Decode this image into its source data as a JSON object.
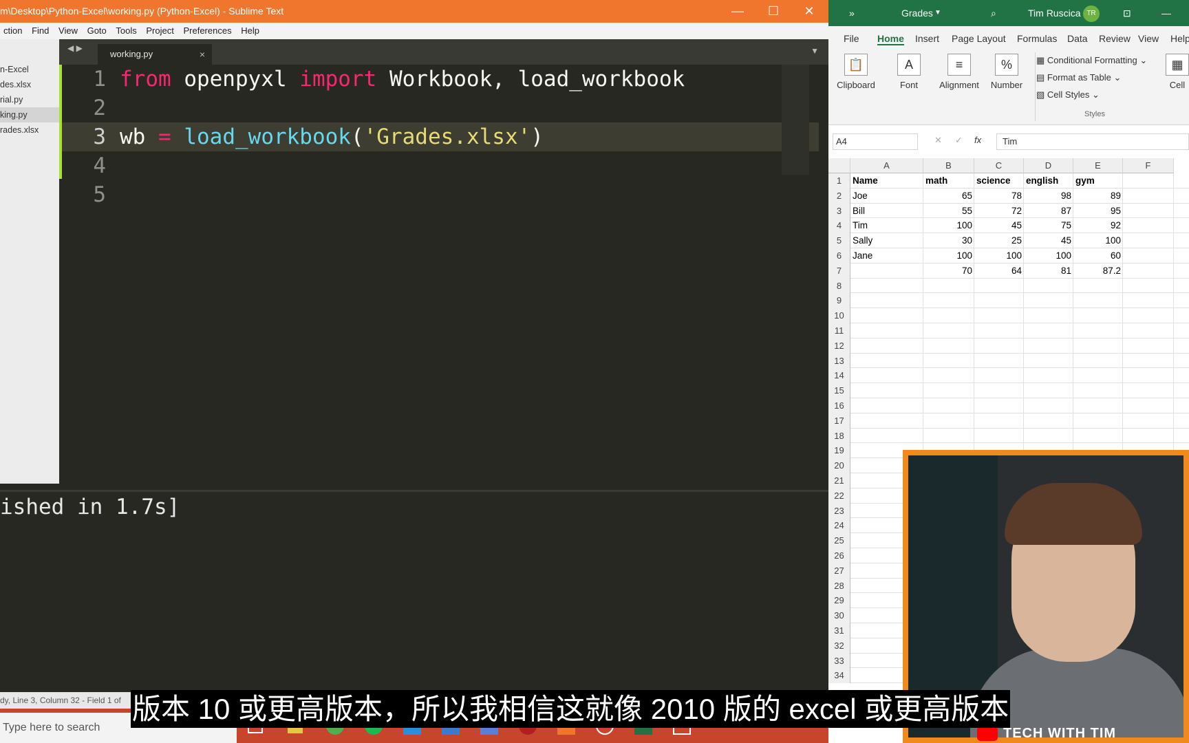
{
  "sublime": {
    "title": "m\\Desktop\\Python-Excel\\working.py (Python-Excel) - Sublime Text",
    "menu": [
      "ction",
      "Find",
      "View",
      "Goto",
      "Tools",
      "Project",
      "Preferences",
      "Help"
    ],
    "sidebar_files": [
      "n-Excel",
      "des.xlsx",
      "rial.py",
      "king.py",
      "rades.xlsx"
    ],
    "tab_label": "working.py",
    "line_numbers": [
      "1",
      "2",
      "3",
      "4",
      "5"
    ],
    "code": {
      "line1": {
        "kw1": "from",
        "mod": " openpyxl ",
        "kw2": "import",
        "rest": " Workbook, load_workbook"
      },
      "line3": {
        "var": "wb ",
        "op": "=",
        "fn": " load_workbook",
        "open": "(",
        "str": "'Grades.xlsx'",
        "close": ")"
      }
    },
    "output": "ished in 1.7s]",
    "status": "dy, Line 3, Column 32 - Field 1 of"
  },
  "taskbar": {
    "search_placeholder": "Type here to search"
  },
  "excel": {
    "doc_title": "Grades",
    "user_name": "Tim Ruscica",
    "user_initials": "TR",
    "menu": [
      "File",
      "Home",
      "Insert",
      "Page Layout",
      "Formulas",
      "Data",
      "Review",
      "View",
      "Help"
    ],
    "ribbon": {
      "clipboard": "Clipboard",
      "font": "Font",
      "alignment": "Alignment",
      "number": "Number",
      "conditional": "Conditional Formatting",
      "format_table": "Format as Table",
      "cell_styles": "Cell Styles",
      "styles": "Styles",
      "cells": "Cell"
    },
    "name_box": "A4",
    "formula_value": "Tim",
    "columns": [
      "A",
      "B",
      "C",
      "D",
      "E",
      "F"
    ],
    "rows": [
      [
        "Name",
        "math",
        "science",
        "english",
        "gym"
      ],
      [
        "Joe",
        "65",
        "78",
        "98",
        "89"
      ],
      [
        "Bill",
        "55",
        "72",
        "87",
        "95"
      ],
      [
        "Tim",
        "100",
        "45",
        "75",
        "92"
      ],
      [
        "Sally",
        "30",
        "25",
        "45",
        "100"
      ],
      [
        "Jane",
        "100",
        "100",
        "100",
        "60"
      ],
      [
        "",
        "70",
        "64",
        "81",
        "87.2"
      ]
    ],
    "row_numbers": [
      "1",
      "2",
      "3",
      "4",
      "5",
      "6",
      "7",
      "8",
      "9",
      "10",
      "11",
      "12",
      "13",
      "14",
      "15",
      "16",
      "17",
      "18",
      "19",
      "20",
      "21",
      "22",
      "23",
      "24",
      "25",
      "26",
      "27",
      "28",
      "29",
      "30",
      "31",
      "32",
      "33",
      "34"
    ]
  },
  "branding": "TECH WITH TIM",
  "subtitle": "版本 10 或更高版本，所以我相信这就像 2010 版的 excel 或更高版本"
}
